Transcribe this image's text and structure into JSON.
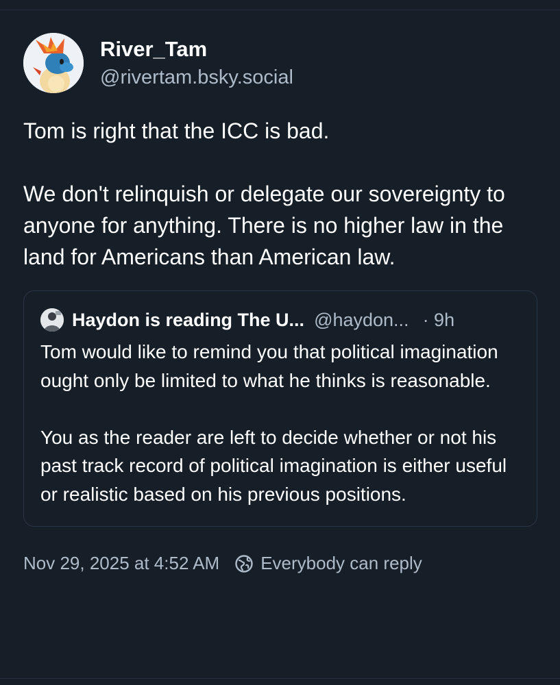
{
  "post": {
    "author": {
      "display_name": "River_Tam",
      "handle": "@rivertam.bsky.social",
      "avatar_icon": "pokemon-avatar"
    },
    "text": "Tom is right that the ICC is bad.\n\nWe don't relinquish or delegate our sovereignty to anyone for anything. There is no higher law in the land for Americans than American law.",
    "quote": {
      "author_name": "Haydon is reading The U...",
      "author_handle": "@haydon...",
      "time": "· 9h",
      "avatar_icon": "quote-author-avatar",
      "text": "Tom would like to remind you that political imagination ought only be limited to what he thinks is reasonable.\n\nYou as the reader are left to decide whether or not his past track record of political imagination is either useful or realistic based on his previous positions."
    },
    "timestamp": "Nov 29, 2025 at 4:52 AM",
    "reply_setting": "Everybody can reply",
    "reply_icon": "globe-icon"
  },
  "colors": {
    "background": "#161e27",
    "text_primary": "#ffffff",
    "text_secondary": "#aebbc9",
    "border": "#2a3746"
  }
}
